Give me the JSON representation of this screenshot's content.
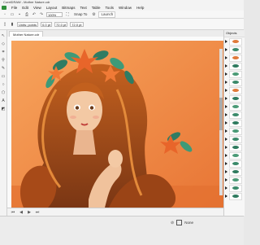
{
  "window": {
    "title": "CorelDRAW - Mother Nature.cdr"
  },
  "menu": [
    "File",
    "Edit",
    "View",
    "Layout",
    "Bitmaps",
    "Text",
    "Table",
    "Tools",
    "Window",
    "Help"
  ],
  "toolbar": {
    "zoom_value": "100%",
    "snap_label": "Snap To",
    "launch_label": "Launch"
  },
  "property_bar": {
    "units": "Units: points",
    "width_value": "0.0 pt",
    "nudge1": "72.0 pt",
    "nudge2": "72.0 pt"
  },
  "document_tab": {
    "label": "Mother Nature.cdr"
  },
  "objects_panel": {
    "title": "Objects",
    "rows": [
      {
        "color": "#e07a3a"
      },
      {
        "color": "#3a8a6a"
      },
      {
        "color": "#e07a3a"
      },
      {
        "color": "#2e7a5e"
      },
      {
        "color": "#4a9a76"
      },
      {
        "color": "#3a8a6a"
      },
      {
        "color": "#e07a3a"
      },
      {
        "color": "#2e7a5e"
      },
      {
        "color": "#4a9a76"
      },
      {
        "color": "#3a8a6a"
      },
      {
        "color": "#2e7a5e"
      },
      {
        "color": "#4a9a76"
      },
      {
        "color": "#3a8a6a"
      },
      {
        "color": "#2e7a5e"
      },
      {
        "color": "#4a9a76"
      },
      {
        "color": "#3a8a6a"
      },
      {
        "color": "#2e7a5e"
      },
      {
        "color": "#4a9a76"
      },
      {
        "color": "#3a8a6a"
      },
      {
        "color": "#2e7a5e"
      }
    ]
  },
  "status": {
    "fill_label": "None"
  },
  "colors": {
    "bg_top": "#f59b56",
    "bg_bottom": "#e8783a",
    "hair": "#b4501d",
    "skin": "#f3c9a4",
    "leaf": "#2f7c63"
  }
}
